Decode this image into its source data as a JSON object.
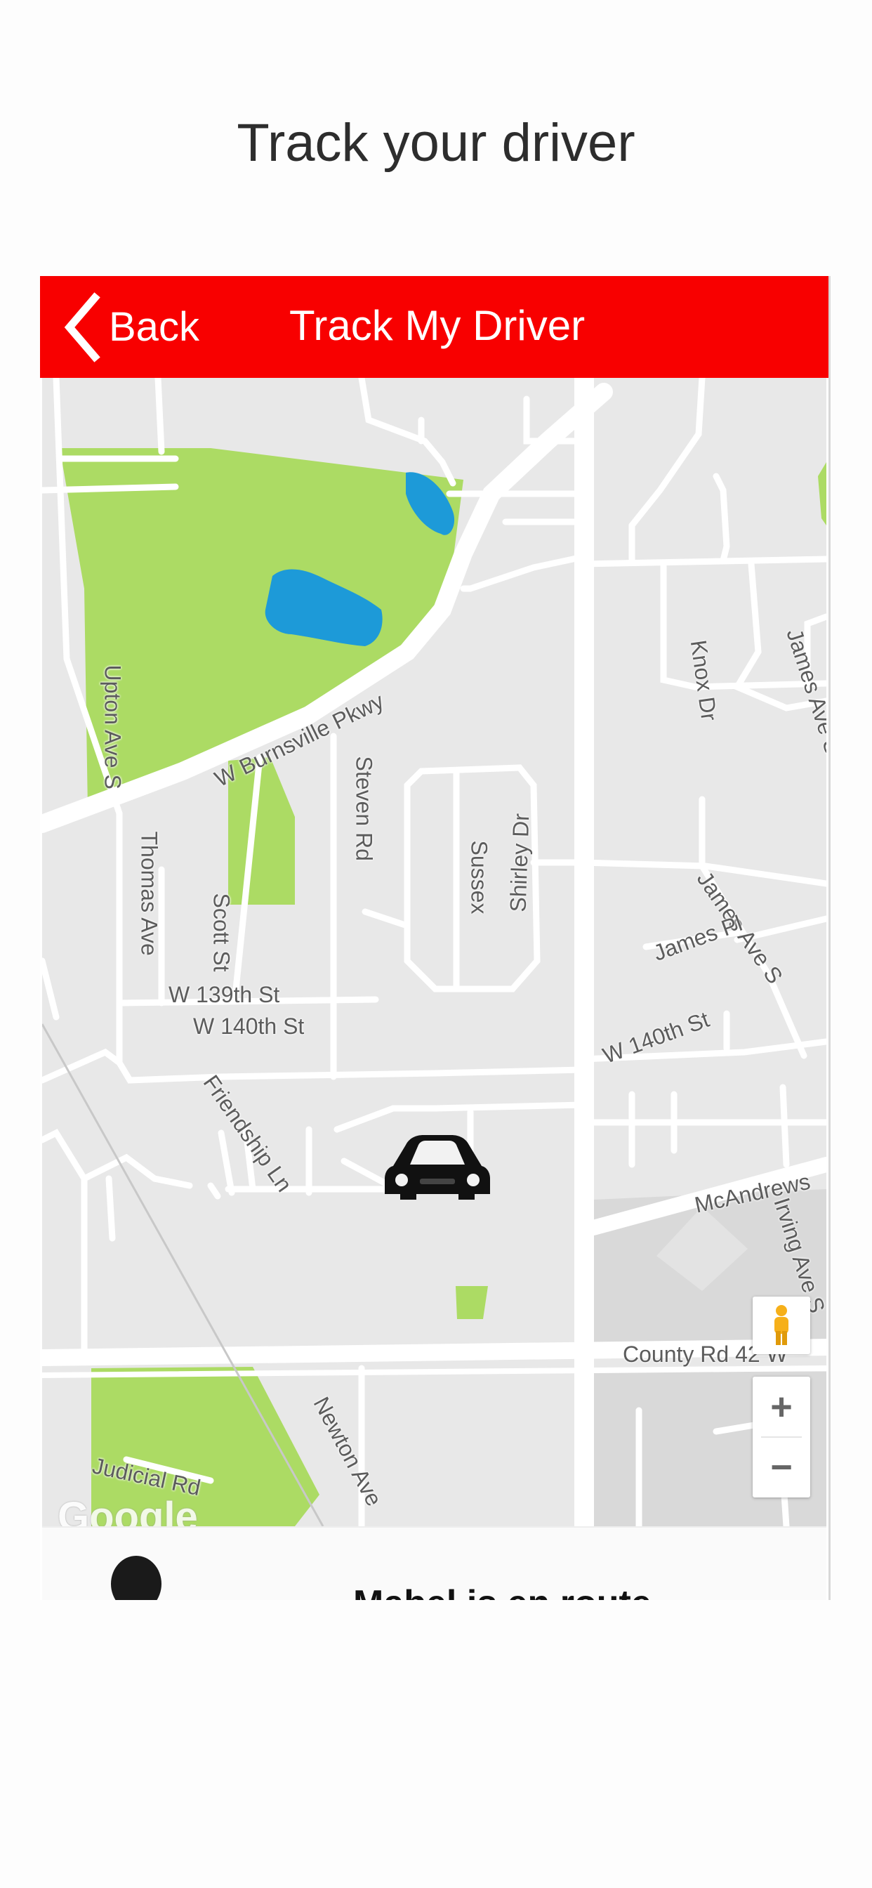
{
  "page": {
    "title": "Track your driver"
  },
  "nav": {
    "back_label": "Back",
    "title": "Track My Driver"
  },
  "map": {
    "streets": {
      "upton": "Upton Ave S",
      "burnsville": "W Burnsville Pkwy",
      "thomas": "Thomas Ave",
      "steven": "Steven Rd",
      "scott": "Scott St",
      "w139": "W 139th St",
      "w140_left": "W 140th St",
      "w140_right": "W 140th St",
      "friendship": "Friendship Ln",
      "knox": "Knox Dr",
      "james_top": "James Ave S",
      "james_mid": "James Ave S",
      "james_pl": "James Pl",
      "shirley": "Shirley Dr",
      "sussex": "Sussex",
      "mcandrews": "McAndrews",
      "irving": "Irving Ave S",
      "county": "County Rd 42 W",
      "judicial": "Judicial Rd",
      "newton": "Newton Ave"
    },
    "controls": {
      "zoom_in": "+",
      "zoom_out": "−"
    },
    "attribution": "Google",
    "colors": {
      "park": "#acdb64",
      "water": "#1d9ad8",
      "road": "#ffffff",
      "land": "#e8e8e8",
      "block": "#d9d9d9"
    }
  },
  "panel": {
    "status_text": "Mabel is en route"
  },
  "icons": {
    "back": "chevron-left-icon",
    "car": "car-icon",
    "pegman": "street-view-icon"
  },
  "colors": {
    "header": "#f80000"
  }
}
